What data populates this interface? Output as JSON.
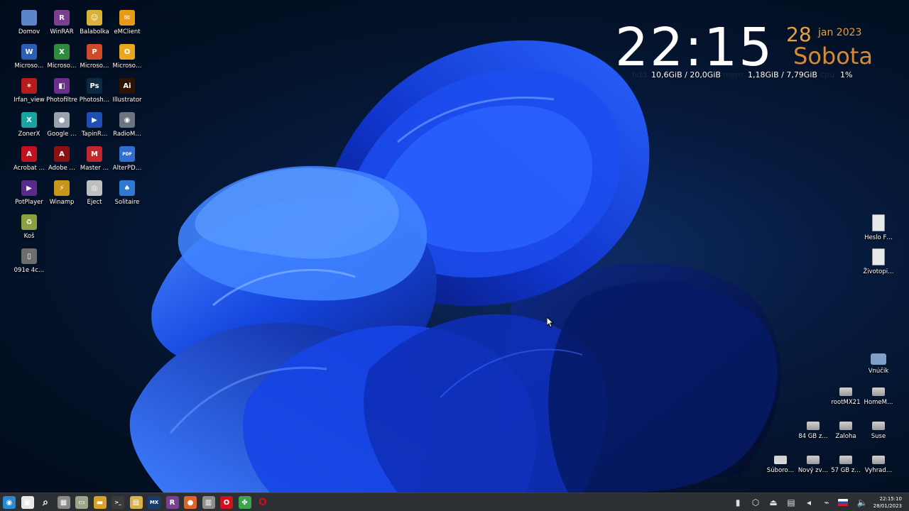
{
  "desktop": {
    "left_icons": [
      {
        "label": "Domov",
        "icon": "home-folder-icon",
        "color": "#5b86c9",
        "glyph": ""
      },
      {
        "label": "WinRAR",
        "icon": "winrar-icon",
        "color": "#7a3f8f",
        "glyph": "R"
      },
      {
        "label": "Balabolka",
        "icon": "balabolka-icon",
        "color": "#d9b23a",
        "glyph": "☺"
      },
      {
        "label": "eMClient",
        "icon": "emclient-icon",
        "color": "#e79a18",
        "glyph": "✉"
      },
      {
        "label": "Microso…",
        "icon": "ms-word-icon",
        "color": "#2b5fb3",
        "glyph": "W"
      },
      {
        "label": "Microso…",
        "icon": "ms-excel-icon",
        "color": "#2f8a3e",
        "glyph": "X"
      },
      {
        "label": "Microso…",
        "icon": "ms-powerpoint-icon",
        "color": "#d04a2a",
        "glyph": "P"
      },
      {
        "label": "Microso…",
        "icon": "ms-outlook-icon",
        "color": "#e7a820",
        "glyph": "O"
      },
      {
        "label": "Irfan_view",
        "icon": "irfanview-icon",
        "color": "#b71c1c",
        "glyph": "✶"
      },
      {
        "label": "Photofiltre",
        "icon": "photofiltre-icon",
        "color": "#6a2e8c",
        "glyph": "◧"
      },
      {
        "label": "Photosh…",
        "icon": "photoshop-icon",
        "color": "#0b2a3f",
        "glyph": "Ps"
      },
      {
        "label": "Illustrator",
        "icon": "illustrator-icon",
        "color": "#2e1400",
        "glyph": "Ai"
      },
      {
        "label": "ZonerX",
        "icon": "zonerx-icon",
        "color": "#1ba3a0",
        "glyph": "X"
      },
      {
        "label": "Google …",
        "icon": "google-earth-icon",
        "color": "#9aa3ad",
        "glyph": "●"
      },
      {
        "label": "TapinR…",
        "icon": "tapinradio-icon",
        "color": "#1f4fb5",
        "glyph": "▶"
      },
      {
        "label": "RadioM…",
        "icon": "radiomaximus-icon",
        "color": "#6b7580",
        "glyph": "◉"
      },
      {
        "label": "Acrobat …",
        "icon": "acrobat-icon",
        "color": "#c1121f",
        "glyph": "A"
      },
      {
        "label": "Adobe …",
        "icon": "adobe-reader-icon",
        "color": "#8c1212",
        "glyph": "A"
      },
      {
        "label": "Master …",
        "icon": "masterpdf-icon",
        "color": "#c0282d",
        "glyph": "M"
      },
      {
        "label": "AlterPD…",
        "icon": "alterpdf-icon",
        "color": "#2f6fd1",
        "glyph": "PDF"
      },
      {
        "label": "PotPlayer",
        "icon": "potplayer-icon",
        "color": "#5a2b8a",
        "glyph": "▶"
      },
      {
        "label": "Winamp",
        "icon": "winamp-icon",
        "color": "#c8961b",
        "glyph": "⚡"
      },
      {
        "label": "Eject",
        "icon": "eject-disc-icon",
        "color": "#bfbfbf",
        "glyph": "◎"
      },
      {
        "label": "Solitaire",
        "icon": "solitaire-icon",
        "color": "#2f7ad1",
        "glyph": "♠"
      },
      {
        "label": "Koš",
        "icon": "trash-icon",
        "color": "#8ca040",
        "glyph": "♻"
      },
      {
        "label": "091e 4c…",
        "icon": "phone-device-icon",
        "color": "#6e6e6e",
        "glyph": "▯"
      }
    ],
    "right_icons": [
      {
        "label": "Heslo F…",
        "icon": "text-file-icon",
        "color": "#e8e8e8"
      },
      {
        "label": "Životopi…",
        "icon": "document-file-icon",
        "color": "#e8e8e8"
      },
      {
        "label": "Vnúčik",
        "icon": "folder-icon",
        "color": "#7ea0c8"
      },
      {
        "label": "rootMX21",
        "icon": "drive-icon",
        "color": "#9a9a9a"
      },
      {
        "label": "HomeM…",
        "icon": "drive-icon",
        "color": "#9a9a9a"
      },
      {
        "label": "84 GB z…",
        "icon": "drive-icon",
        "color": "#9a9a9a"
      },
      {
        "label": "Zaloha",
        "icon": "drive-icon",
        "color": "#9a9a9a"
      },
      {
        "label": "Suse",
        "icon": "drive-icon",
        "color": "#9a9a9a"
      },
      {
        "label": "Súboro…",
        "icon": "drive-icon",
        "color": "#d8d8d8"
      },
      {
        "label": "Nový zv…",
        "icon": "drive-icon",
        "color": "#9a9a9a"
      },
      {
        "label": "57 GB z…",
        "icon": "drive-icon",
        "color": "#9a9a9a"
      },
      {
        "label": "Vyhrad…",
        "icon": "drive-icon",
        "color": "#9a9a9a"
      }
    ]
  },
  "conky": {
    "time": "22:15",
    "day": "28",
    "month_year": "jan 2023",
    "weekday": "Sobota",
    "hdd_label": "hdd",
    "hdd_value": "10,6GiB / 20,0GiB",
    "mem_label": "mem",
    "mem_value": "1,18GiB / 7,79GiB",
    "cpu_label": "cpu",
    "cpu_value": "1%",
    "accent_color": "#e7a03b"
  },
  "taskbar": {
    "launchers": [
      {
        "icon": "start-menu-icon",
        "color": "#2a8ad1",
        "glyph": "◉"
      },
      {
        "icon": "show-desktop-icon",
        "color": "#e8e8e8",
        "glyph": "▣"
      },
      {
        "icon": "search-icon",
        "color": "transparent",
        "glyph": "⌕"
      },
      {
        "icon": "app-grid-icon",
        "color": "#8a8a8a",
        "glyph": "▦"
      },
      {
        "icon": "screenshot-icon",
        "color": "#9aa58a",
        "glyph": "▭"
      },
      {
        "icon": "file-manager-icon",
        "color": "#d6a22a",
        "glyph": "▬"
      },
      {
        "icon": "terminal-icon",
        "color": "#3b3b3b",
        "glyph": ">_"
      },
      {
        "icon": "notes-icon",
        "color": "#d9b14a",
        "glyph": "▤"
      },
      {
        "icon": "mx-tools-icon",
        "color": "#1b3c6a",
        "glyph": "MX"
      },
      {
        "icon": "winrar-icon",
        "color": "#7a3f8f",
        "glyph": "R"
      },
      {
        "icon": "firefox-icon",
        "color": "#e0632b",
        "glyph": "●"
      },
      {
        "icon": "printer-icon",
        "color": "#8e8e8e",
        "glyph": "▥"
      },
      {
        "icon": "opera-icon",
        "color": "#d0121f",
        "glyph": "O"
      },
      {
        "icon": "pinwheel-icon",
        "color": "#3aa54a",
        "glyph": "✤"
      },
      {
        "icon": "opera-gx-icon",
        "color": "transparent",
        "glyph": "O"
      }
    ],
    "tray": [
      {
        "icon": "battery-power-icon"
      },
      {
        "icon": "package-updates-icon"
      },
      {
        "icon": "eject-icon"
      },
      {
        "icon": "clipboard-icon"
      },
      {
        "icon": "speaker-small-icon"
      },
      {
        "icon": "network-icon"
      },
      {
        "icon": "keyboard-layout-sk-flag-icon"
      },
      {
        "icon": "volume-icon"
      }
    ],
    "clock_time": "22:15:10",
    "clock_date": "28/01/2023"
  }
}
